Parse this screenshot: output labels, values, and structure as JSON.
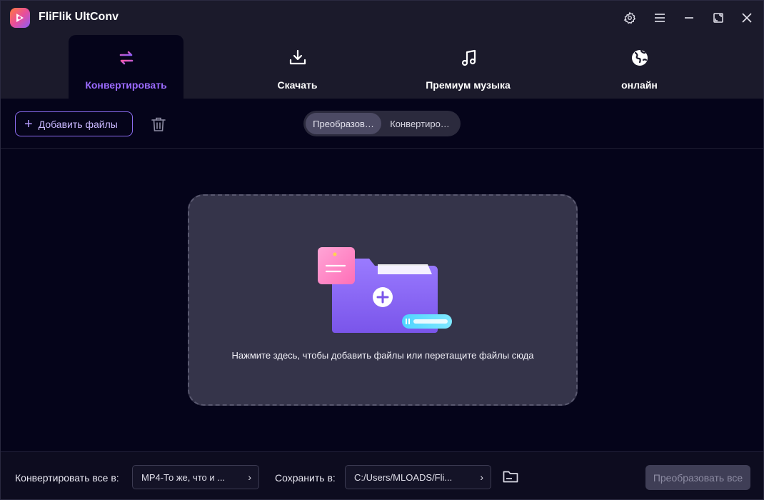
{
  "app": {
    "title": "FliFlik UltConv"
  },
  "window_controls": [
    "gear-icon",
    "menu-icon",
    "minimize-icon",
    "maximize-icon",
    "close-icon"
  ],
  "tabs": [
    {
      "label": "Конвертировать",
      "icon": "convert-arrows-icon",
      "active": true
    },
    {
      "label": "Скачать",
      "icon": "download-icon",
      "active": false
    },
    {
      "label": "Премиум музыка",
      "icon": "music-note-icon",
      "active": false
    },
    {
      "label": "онлайн",
      "icon": "globe-icon",
      "active": false
    }
  ],
  "toolbar": {
    "add_files_label": "Добавить файлы",
    "segment": {
      "active": "Преобразов…",
      "inactive": "Конвертиро…"
    }
  },
  "dropzone": {
    "hint": "Нажмите здесь, чтобы добавить файлы или перетащите файлы сюда"
  },
  "bottom": {
    "convert_all_label": "Конвертировать все в:",
    "format_value": "MP4-То же, что и ...",
    "save_label": "Сохранить в:",
    "path_value": "C:/Users/MLOADS/Fli...",
    "convert_all_button": "Преобразовать все"
  },
  "colors": {
    "accent": "#9b6bff",
    "panel": "#1b1a2b",
    "dropzone": "#35344a"
  }
}
